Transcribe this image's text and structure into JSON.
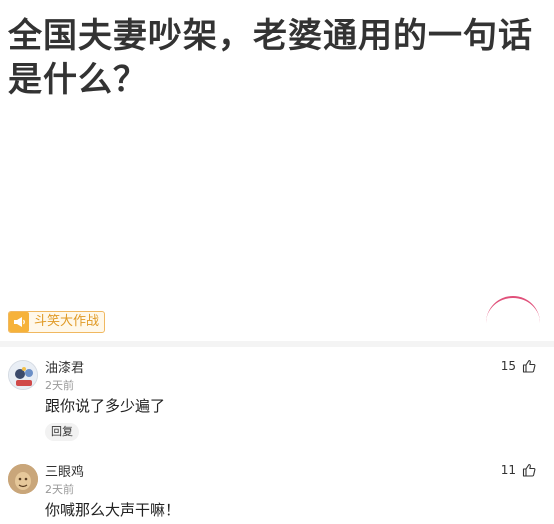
{
  "post": {
    "title": "全国夫妻吵架，老婆通用的一句话是什么？"
  },
  "tag": {
    "icon": "megaphone-icon",
    "label": "斗笑大作战"
  },
  "comments": [
    {
      "author": "油漆君",
      "time": "2天前",
      "text": "跟你说了多少遍了",
      "reply_label": "回复",
      "likes": "15"
    },
    {
      "author": "三眼鸡",
      "time": "2天前",
      "text": "你喊那么大声干嘛！",
      "likes": "11"
    }
  ],
  "colors": {
    "tag_accent": "#f6b23a",
    "tag_text": "#e09a26",
    "arc": "#e0507a"
  }
}
